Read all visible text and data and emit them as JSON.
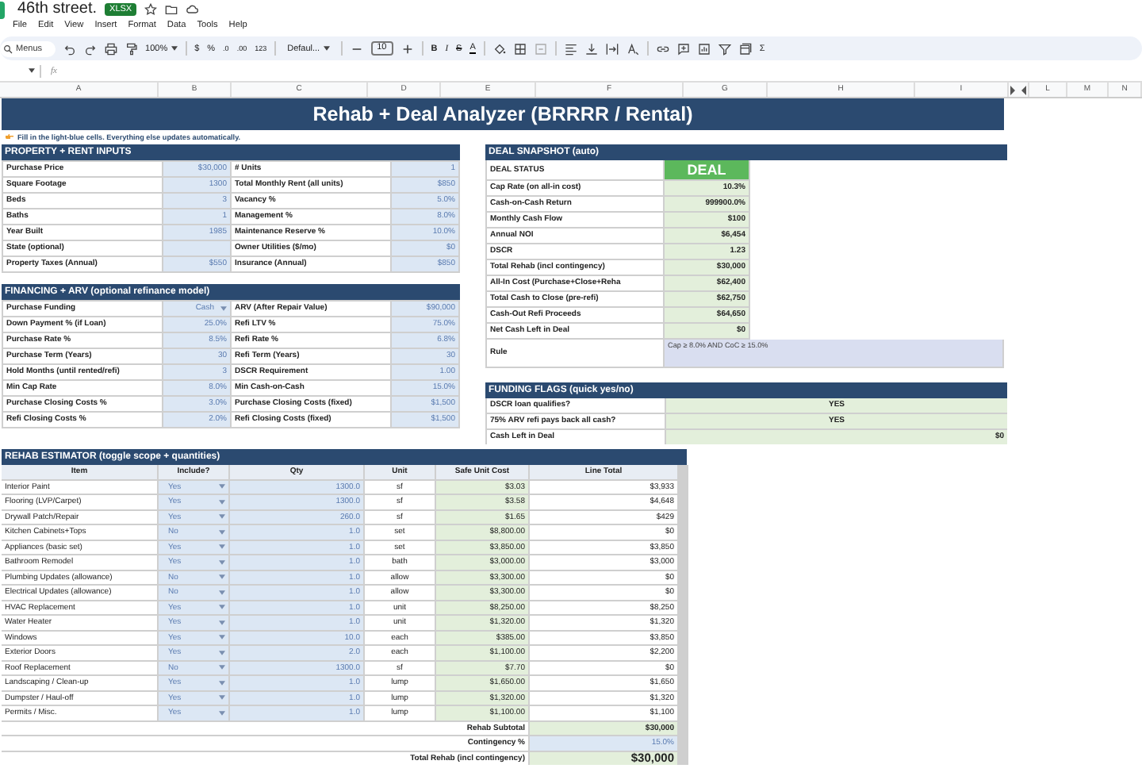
{
  "document": {
    "title": "46th street.",
    "badge": "XLSX"
  },
  "menu": [
    "File",
    "Edit",
    "View",
    "Insert",
    "Format",
    "Data",
    "Tools",
    "Help"
  ],
  "toolbar": {
    "search_placeholder": "Menus",
    "zoom": "100%",
    "currency": "$",
    "percent": "%",
    "decrease_decimals": ".0",
    "increase_decimals": ".00",
    "number_format": "123",
    "font": "Defaul...",
    "font_size": "10",
    "bold": "B",
    "italic": "I",
    "strikethrough": "S",
    "text_color": "A",
    "functions": "Σ"
  },
  "formula_bar": {
    "function_label": "fx"
  },
  "columns": [
    "A",
    "B",
    "C",
    "D",
    "E",
    "F",
    "G",
    "H",
    "I",
    "L",
    "M",
    "N"
  ],
  "banner": "Rehab + Deal Analyzer (BRRRR / Rental)",
  "note": "Fill in the light-blue cells. Everything else updates automatically.",
  "property_inputs": {
    "title": "PROPERTY + RENT INPUTS",
    "rows": [
      {
        "label": "Purchase Price",
        "value": "$30,000",
        "label2": "# Units",
        "value2": "1"
      },
      {
        "label": "Square Footage",
        "value": "1300",
        "label2": "Total Monthly Rent (all units)",
        "value2": "$850"
      },
      {
        "label": "Beds",
        "value": "3",
        "label2": "Vacancy %",
        "value2": "5.0%"
      },
      {
        "label": "Baths",
        "value": "1",
        "label2": "Management %",
        "value2": "8.0%"
      },
      {
        "label": "Year Built",
        "value": "1985",
        "label2": "Maintenance Reserve %",
        "value2": "10.0%"
      },
      {
        "label": "State (optional)",
        "label2": "Owner Utilities ($/mo)",
        "value2": "$0"
      },
      {
        "label": "Property Taxes (Annual)",
        "value": "$550",
        "label2": "Insurance (Annual)",
        "value2": "$850"
      }
    ]
  },
  "financing": {
    "title": "FINANCING + ARV (optional refinance model)",
    "rows": [
      {
        "label": "Purchase Funding",
        "value": "Cash",
        "dropdown": true,
        "label2": "ARV (After Repair Value)",
        "value2": "$90,000"
      },
      {
        "label": "Down Payment % (if Loan)",
        "value": "25.0%",
        "dropdown": false,
        "label2": "Refi LTV %",
        "value2": "75.0%"
      },
      {
        "label": "Purchase Rate %",
        "value": "8.5%",
        "dropdown": false,
        "label2": "Refi Rate %",
        "value2": "6.8%"
      },
      {
        "label": "Purchase Term (Years)",
        "value": "30",
        "dropdown": false,
        "label2": "Refi Term (Years)",
        "value2": "30"
      },
      {
        "label": "Hold Months (until rented/refi)",
        "value": "3",
        "dropdown": false,
        "label2": "DSCR Requirement",
        "value2": "1.00"
      },
      {
        "label": "Min Cap Rate",
        "value": "8.0%",
        "dropdown": false,
        "label2": "Min Cash-on-Cash",
        "value2": "15.0%"
      },
      {
        "label": "Purchase Closing Costs %",
        "value": "3.0%",
        "dropdown": false,
        "label2": "Purchase Closing Costs (fixed)",
        "value2": "$1,500"
      },
      {
        "label": "Refi Closing Costs %",
        "value": "2.0%",
        "dropdown": false,
        "label2": "Refi Closing Costs (fixed)",
        "value2": "$1,500"
      }
    ]
  },
  "snapshot": {
    "title": "DEAL SNAPSHOT (auto)",
    "status_label": "DEAL STATUS",
    "status": "DEAL",
    "rows": [
      {
        "label": "Cap Rate (on all-in cost)",
        "value": "10.3%"
      },
      {
        "label": "Cash-on-Cash Return",
        "value": "999900.0%"
      },
      {
        "label": "Monthly Cash Flow",
        "value": "$100"
      },
      {
        "label": "Annual NOI",
        "value": "$6,454"
      },
      {
        "label": "DSCR",
        "value": "1.23"
      },
      {
        "label": "Total Rehab (incl contingency)",
        "value": "$30,000"
      },
      {
        "label": "All-In Cost (Purchase+Close+Reha",
        "value": "$62,400"
      },
      {
        "label": "Total Cash to Close (pre-refi)",
        "value": "$62,750"
      },
      {
        "label": "Cash-Out Refi Proceeds",
        "value": "$64,650"
      },
      {
        "label": "Net Cash Left in Deal",
        "value": "$0"
      }
    ],
    "rule_label": "Rule",
    "rule": "Cap ≥ 8.0% AND CoC ≥ 15.0%"
  },
  "funding_flags": {
    "title": "FUNDING FLAGS (quick yes/no)",
    "rows": [
      {
        "label": "DSCR loan qualifies?",
        "value": "YES",
        "kind": "flag"
      },
      {
        "label": "75% ARV refi pays back all cash?",
        "value": "YES",
        "kind": "flag"
      },
      {
        "label": "Cash Left in Deal",
        "value": "$0",
        "kind": "amount"
      }
    ]
  },
  "rehab": {
    "title": "REHAB ESTIMATOR (toggle scope + quantities)",
    "columns": [
      "Item",
      "Include?",
      "Qty",
      "Unit",
      "Safe Unit Cost",
      "Line Total"
    ],
    "rows": [
      {
        "item": "Interior Paint",
        "include": "Yes",
        "qty": "1300.0",
        "unit": "sf",
        "cost": "$3.03",
        "total": "$3,933"
      },
      {
        "item": "Flooring (LVP/Carpet)",
        "include": "Yes",
        "qty": "1300.0",
        "unit": "sf",
        "cost": "$3.58",
        "total": "$4,648"
      },
      {
        "item": "Drywall Patch/Repair",
        "include": "Yes",
        "qty": "260.0",
        "unit": "sf",
        "cost": "$1.65",
        "total": "$429"
      },
      {
        "item": "Kitchen Cabinets+Tops",
        "include": "No",
        "qty": "1.0",
        "unit": "set",
        "cost": "$8,800.00",
        "total": "$0"
      },
      {
        "item": "Appliances (basic set)",
        "include": "Yes",
        "qty": "1.0",
        "unit": "set",
        "cost": "$3,850.00",
        "total": "$3,850"
      },
      {
        "item": "Bathroom Remodel",
        "include": "Yes",
        "qty": "1.0",
        "unit": "bath",
        "cost": "$3,000.00",
        "total": "$3,000"
      },
      {
        "item": "Plumbing Updates (allowance)",
        "include": "No",
        "qty": "1.0",
        "unit": "allow",
        "cost": "$3,300.00",
        "total": "$0"
      },
      {
        "item": "Electrical Updates (allowance)",
        "include": "No",
        "qty": "1.0",
        "unit": "allow",
        "cost": "$3,300.00",
        "total": "$0"
      },
      {
        "item": "HVAC Replacement",
        "include": "Yes",
        "qty": "1.0",
        "unit": "unit",
        "cost": "$8,250.00",
        "total": "$8,250"
      },
      {
        "item": "Water Heater",
        "include": "Yes",
        "qty": "1.0",
        "unit": "unit",
        "cost": "$1,320.00",
        "total": "$1,320"
      },
      {
        "item": "Windows",
        "include": "Yes",
        "qty": "10.0",
        "unit": "each",
        "cost": "$385.00",
        "total": "$3,850"
      },
      {
        "item": "Exterior Doors",
        "include": "Yes",
        "qty": "2.0",
        "unit": "each",
        "cost": "$1,100.00",
        "total": "$2,200"
      },
      {
        "item": "Roof Replacement",
        "include": "No",
        "qty": "1300.0",
        "unit": "sf",
        "cost": "$7.70",
        "total": "$0"
      },
      {
        "item": "Landscaping / Clean-up",
        "include": "Yes",
        "qty": "1.0",
        "unit": "lump",
        "cost": "$1,650.00",
        "total": "$1,650"
      },
      {
        "item": "Dumpster / Haul-off",
        "include": "Yes",
        "qty": "1.0",
        "unit": "lump",
        "cost": "$1,320.00",
        "total": "$1,320"
      },
      {
        "item": "Permits / Misc.",
        "include": "Yes",
        "qty": "1.0",
        "unit": "lump",
        "cost": "$1,100.00",
        "total": "$1,100"
      }
    ],
    "subtotal_label": "Rehab Subtotal",
    "subtotal": "$30,000",
    "contingency_label": "Contingency %",
    "contingency": "15.0%",
    "total_label": "Total Rehab (incl contingency)",
    "total": "$30,000"
  }
}
